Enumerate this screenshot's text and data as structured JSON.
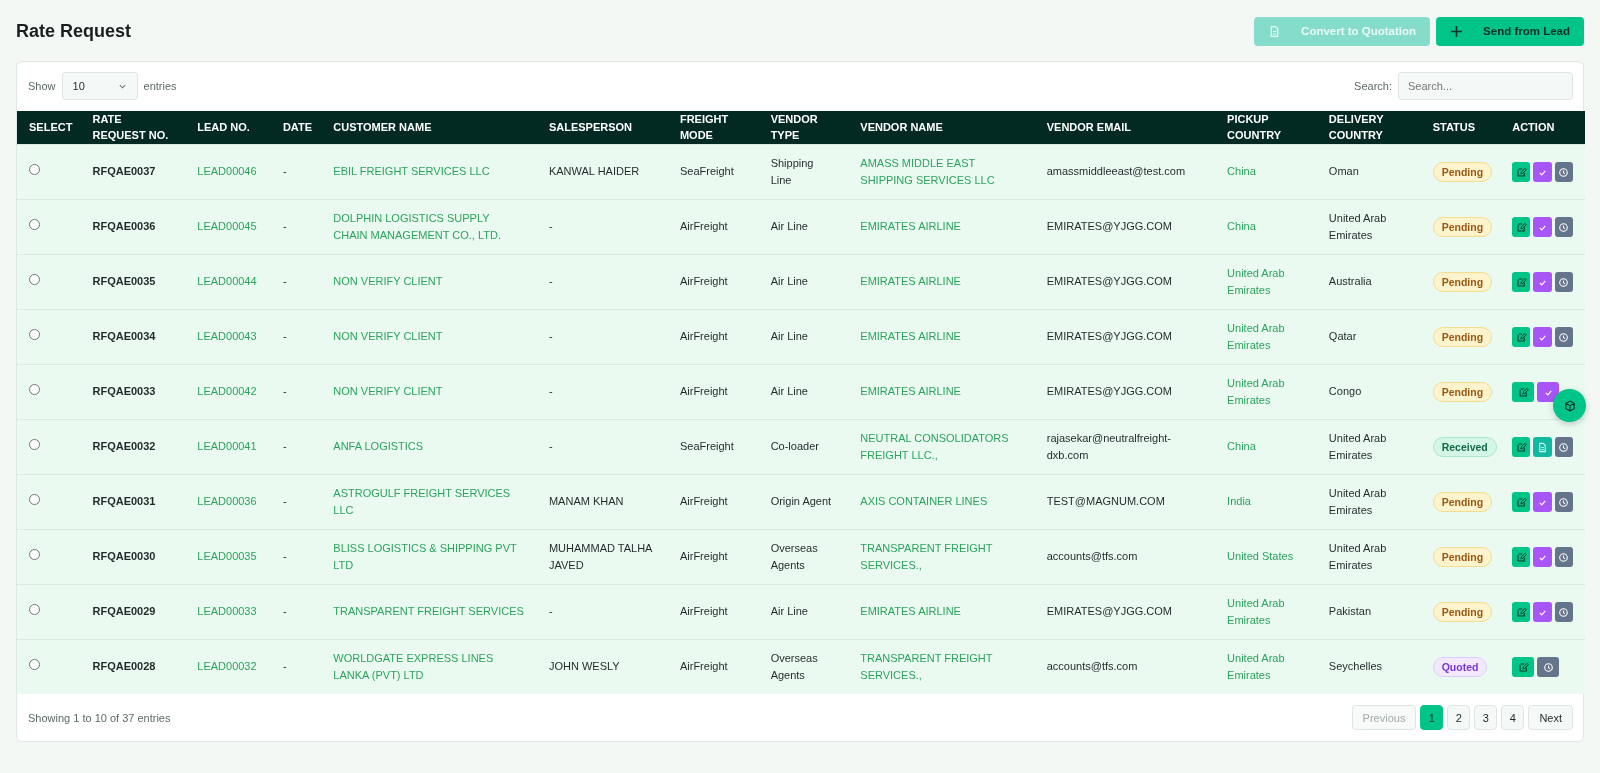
{
  "title": "Rate Request",
  "header_buttons": [
    {
      "label": "Convert to Quotation",
      "kind": "convert",
      "disabled": true
    },
    {
      "label": "Send from Lead",
      "kind": "add",
      "disabled": false
    }
  ],
  "length_control": {
    "label_before": "Show",
    "value": "10",
    "label_after": "entries"
  },
  "search": {
    "label": "Search:",
    "placeholder": "Search..."
  },
  "table": {
    "columns": [
      "SELECT",
      "RATE REQUEST NO.",
      "LEAD NO.",
      "DATE",
      "CUSTOMER NAME",
      "SALESPERSON",
      "FREIGHT MODE",
      "VENDOR TYPE",
      "VENDOR NAME",
      "VENDOR EMAIL",
      "PICKUP COUNTRY",
      "DELIVERY COUNTRY",
      "STATUS",
      "ACTION"
    ],
    "rows": [
      {
        "selected": false,
        "request_no": "RFQAE0037",
        "lead_no": "LEAD00046",
        "date": "-",
        "customer": "EBIL FREIGHT SERVICES LLC",
        "salesperson": "KANWAL HAIDER",
        "freight_mode": "SeaFreight",
        "vendor_type": "Shipping Line",
        "vendor_name": "AMASS MIDDLE EAST SHIPPING SERVICES LLC",
        "vendor_email": "amassmiddleeast@test.com",
        "pickup": "China",
        "delivery": "Oman",
        "status": {
          "label": "Pending",
          "kind": "pending"
        },
        "actions": [
          {
            "kind": "edit"
          },
          {
            "kind": "approve"
          },
          {
            "kind": "history"
          }
        ]
      },
      {
        "selected": false,
        "request_no": "RFQAE0036",
        "lead_no": "LEAD00045",
        "date": "-",
        "customer": "DOLPHIN LOGISTICS SUPPLY CHAIN MANAGEMENT CO., LTD.",
        "salesperson": "-",
        "freight_mode": "AirFreight",
        "vendor_type": "Air Line",
        "vendor_name": "EMIRATES AIRLINE",
        "vendor_email": "EMIRATES@YJGG.COM",
        "pickup": "China",
        "delivery": "United Arab Emirates",
        "status": {
          "label": "Pending",
          "kind": "pending"
        },
        "actions": [
          {
            "kind": "edit"
          },
          {
            "kind": "approve"
          },
          {
            "kind": "history"
          }
        ]
      },
      {
        "selected": false,
        "request_no": "RFQAE0035",
        "lead_no": "LEAD00044",
        "date": "-",
        "customer": "NON VERIFY CLIENT",
        "salesperson": "-",
        "freight_mode": "AirFreight",
        "vendor_type": "Air Line",
        "vendor_name": "EMIRATES AIRLINE",
        "vendor_email": "EMIRATES@YJGG.COM",
        "pickup": "United Arab Emirates",
        "delivery": "Australia",
        "status": {
          "label": "Pending",
          "kind": "pending"
        },
        "actions": [
          {
            "kind": "edit"
          },
          {
            "kind": "approve"
          },
          {
            "kind": "history"
          }
        ]
      },
      {
        "selected": false,
        "request_no": "RFQAE0034",
        "lead_no": "LEAD00043",
        "date": "-",
        "customer": "NON VERIFY CLIENT",
        "salesperson": "-",
        "freight_mode": "AirFreight",
        "vendor_type": "Air Line",
        "vendor_name": "EMIRATES AIRLINE",
        "vendor_email": "EMIRATES@YJGG.COM",
        "pickup": "United Arab Emirates",
        "delivery": "Qatar",
        "status": {
          "label": "Pending",
          "kind": "pending"
        },
        "actions": [
          {
            "kind": "edit"
          },
          {
            "kind": "approve"
          },
          {
            "kind": "history"
          }
        ]
      },
      {
        "selected": false,
        "request_no": "RFQAE0033",
        "lead_no": "LEAD00042",
        "date": "-",
        "customer": "NON VERIFY CLIENT",
        "salesperson": "-",
        "freight_mode": "AirFreight",
        "vendor_type": "Air Line",
        "vendor_name": "EMIRATES AIRLINE",
        "vendor_email": "EMIRATES@YJGG.COM",
        "pickup": "United Arab Emirates",
        "delivery": "Congo",
        "status": {
          "label": "Pending",
          "kind": "pending"
        },
        "actions": [
          {
            "kind": "edit"
          },
          {
            "kind": "approve"
          }
        ]
      },
      {
        "selected": false,
        "request_no": "RFQAE0032",
        "lead_no": "LEAD00041",
        "date": "-",
        "customer": "ANFA LOGISTICS",
        "salesperson": "-",
        "freight_mode": "SeaFreight",
        "vendor_type": "Co-loader",
        "vendor_name": "NEUTRAL CONSOLIDATORS FREIGHT LLC.,",
        "vendor_email": "rajasekar@neutralfreight-dxb.com",
        "pickup": "China",
        "delivery": "United Arab Emirates",
        "status": {
          "label": "Received",
          "kind": "received"
        },
        "actions": [
          {
            "kind": "edit"
          },
          {
            "kind": "document"
          },
          {
            "kind": "history"
          }
        ]
      },
      {
        "selected": false,
        "request_no": "RFQAE0031",
        "lead_no": "LEAD00036",
        "date": "-",
        "customer": "ASTROGULF FREIGHT SERVICES LLC",
        "salesperson": "MANAM KHAN",
        "freight_mode": "AirFreight",
        "vendor_type": "Origin Agent",
        "vendor_name": "AXIS CONTAINER LINES",
        "vendor_email": "TEST@MAGNUM.COM",
        "pickup": "India",
        "delivery": "United Arab Emirates",
        "status": {
          "label": "Pending",
          "kind": "pending"
        },
        "actions": [
          {
            "kind": "edit"
          },
          {
            "kind": "approve"
          },
          {
            "kind": "history"
          }
        ]
      },
      {
        "selected": false,
        "request_no": "RFQAE0030",
        "lead_no": "LEAD00035",
        "date": "-",
        "customer": "BLISS LOGISTICS & SHIPPING PVT LTD",
        "salesperson": "MUHAMMAD TALHA JAVED",
        "freight_mode": "AirFreight",
        "vendor_type": "Overseas Agents",
        "vendor_name": "TRANSPARENT FREIGHT SERVICES.,",
        "vendor_email": "accounts@tfs.com",
        "pickup": "United States",
        "delivery": "United Arab Emirates",
        "status": {
          "label": "Pending",
          "kind": "pending"
        },
        "actions": [
          {
            "kind": "edit"
          },
          {
            "kind": "approve"
          },
          {
            "kind": "history"
          }
        ]
      },
      {
        "selected": false,
        "request_no": "RFQAE0029",
        "lead_no": "LEAD00033",
        "date": "-",
        "customer": "TRANSPARENT FREIGHT SERVICES",
        "salesperson": "-",
        "freight_mode": "AirFreight",
        "vendor_type": "Air Line",
        "vendor_name": "EMIRATES AIRLINE",
        "vendor_email": "EMIRATES@YJGG.COM",
        "pickup": "United Arab Emirates",
        "delivery": "Pakistan",
        "status": {
          "label": "Pending",
          "kind": "pending"
        },
        "actions": [
          {
            "kind": "edit"
          },
          {
            "kind": "approve"
          },
          {
            "kind": "history"
          }
        ]
      },
      {
        "selected": false,
        "request_no": "RFQAE0028",
        "lead_no": "LEAD00032",
        "date": "-",
        "customer": "WORLDGATE EXPRESS LINES LANKA (PVT) LTD",
        "salesperson": "JOHN WESLY",
        "freight_mode": "AirFreight",
        "vendor_type": "Overseas Agents",
        "vendor_name": "TRANSPARENT FREIGHT SERVICES.,",
        "vendor_email": "accounts@tfs.com",
        "pickup": "United Arab Emirates",
        "delivery": "Seychelles",
        "status": {
          "label": "Quoted",
          "kind": "quoted"
        },
        "actions": [
          {
            "kind": "edit"
          },
          {
            "kind": "history"
          }
        ]
      }
    ]
  },
  "info": "Showing 1 to 10 of 37 entries",
  "pagination": [
    {
      "label": "Previous",
      "kind": "nav",
      "disabled": true,
      "selected": false
    },
    {
      "label": "1",
      "kind": "page",
      "disabled": false,
      "selected": true
    },
    {
      "label": "2",
      "kind": "page",
      "disabled": false,
      "selected": false
    },
    {
      "label": "3",
      "kind": "page",
      "disabled": false,
      "selected": false
    },
    {
      "label": "4",
      "kind": "page",
      "disabled": false,
      "selected": false
    },
    {
      "label": "Next",
      "kind": "nav",
      "disabled": false,
      "selected": false
    }
  ]
}
